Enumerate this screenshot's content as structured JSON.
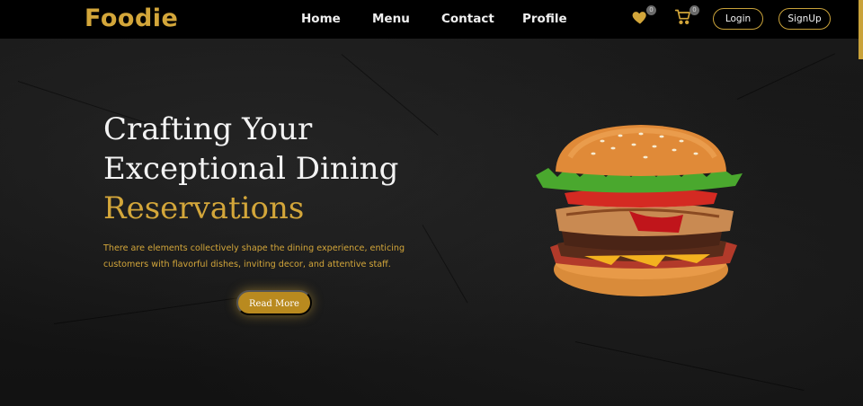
{
  "brand": {
    "name": "Foodie"
  },
  "nav": {
    "links": [
      "Home",
      "Menu",
      "Contact",
      "Profile"
    ],
    "wishlist_count": "0",
    "cart_count": "0",
    "login_label": "Login",
    "signup_label": "SignUp"
  },
  "hero": {
    "title_line1": "Crafting Your",
    "title_line2": "Exceptional Dining",
    "title_accent": "Reservations",
    "description": "There are elements collectively shape the dining experience, enticing customers with flavorful dishes, inviting decor, and attentive staff.",
    "cta_label": "Read More"
  },
  "colors": {
    "accent": "#d3a63a",
    "background": "#141414",
    "navbar": "#000000",
    "text": "#f3f3f3"
  },
  "icons": [
    "heart-icon",
    "cart-icon"
  ]
}
